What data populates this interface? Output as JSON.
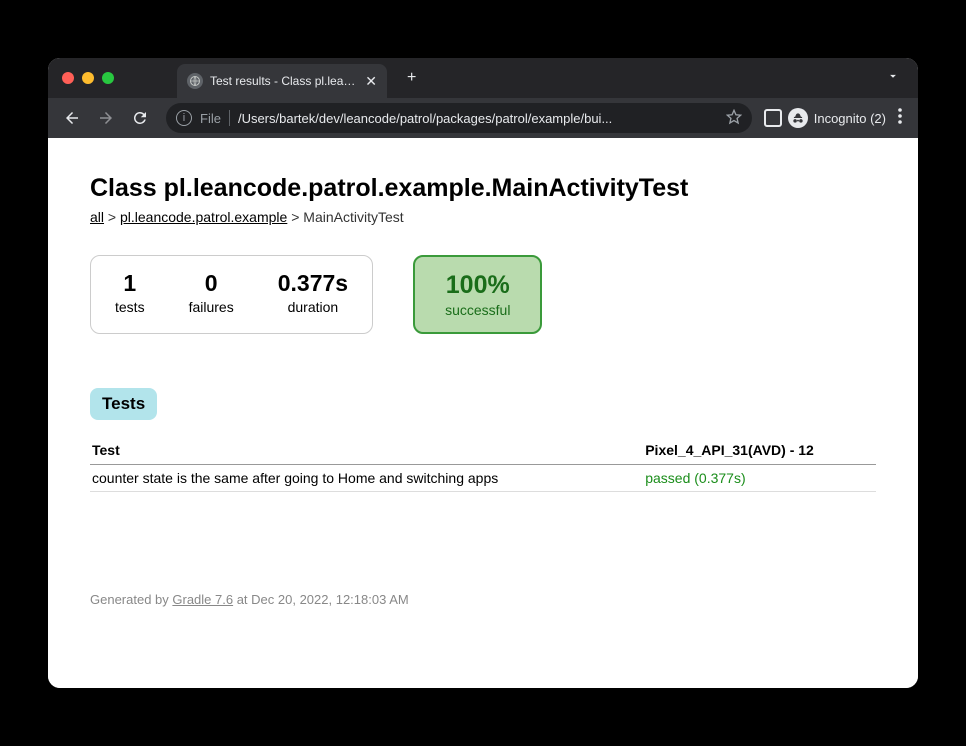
{
  "browser": {
    "tab_title": "Test results - Class pl.leancode",
    "address_scheme": "File",
    "address_path": "/Users/bartek/dev/leancode/patrol/packages/patrol/example/bui...",
    "incognito_label": "Incognito (2)"
  },
  "page": {
    "title": "Class pl.leancode.patrol.example.MainActivityTest",
    "breadcrumb": {
      "all": "all",
      "sep": " > ",
      "pkg": "pl.leancode.patrol.example",
      "current": "MainActivityTest"
    },
    "stats": {
      "tests_value": "1",
      "tests_label": "tests",
      "failures_value": "0",
      "failures_label": "failures",
      "duration_value": "0.377s",
      "duration_label": "duration"
    },
    "success": {
      "value": "100%",
      "label": "successful"
    },
    "tests_tab": "Tests",
    "table": {
      "col_test": "Test",
      "col_device": "Pixel_4_API_31(AVD) - 12",
      "row1_name": "counter state is the same after going to Home and switching apps",
      "row1_result": "passed (0.377s)"
    },
    "footer": {
      "prefix": "Generated by ",
      "gradle": "Gradle 7.6",
      "suffix": " at Dec 20, 2022, 12:18:03 AM"
    }
  }
}
